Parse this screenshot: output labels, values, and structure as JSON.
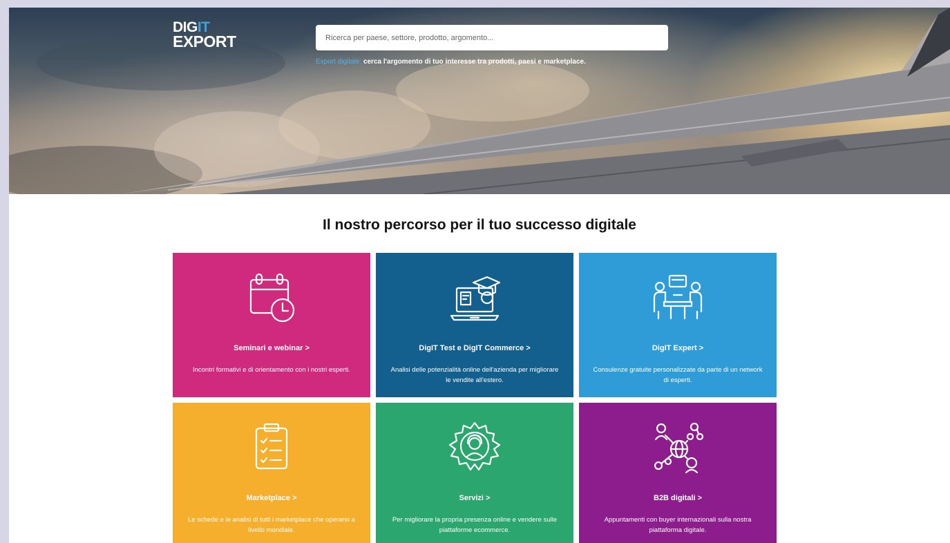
{
  "logo": {
    "line1_a": "DIG",
    "line1_b": "IT",
    "line2": "EXPORT"
  },
  "search": {
    "placeholder": "Ricerca per paese, settore, prodotto, argomento..."
  },
  "hint": {
    "lead": "Export digitale:",
    "text": " cerca l'argomento di tuo interesse tra prodotti, paesi e marketplace."
  },
  "section": {
    "title": "Il nostro percorso per il tuo successo digitale"
  },
  "cards": [
    {
      "title": "Seminari e webinar >",
      "desc": "Incontri formativi e di orientamento con i nostri esperti.",
      "icon": "calendar-clock-icon",
      "color": "#cf2a7d"
    },
    {
      "title": "DigIT Test e DigIT Commerce >",
      "desc": "Analisi delle potenzialità online dell'azienda per migliorare le vendite all'estero.",
      "icon": "laptop-graduation-icon",
      "color": "#135f8e"
    },
    {
      "title": "DigIT Expert >",
      "desc": "Consulenze gratuite personalizzate da parte di un network di esperti.",
      "icon": "meeting-table-icon",
      "color": "#2f9cd8"
    },
    {
      "title": "Marketplace >",
      "desc": "Le schede e le analisi di tutti i marketplace che operano a livello mondiale.",
      "icon": "checklist-icon",
      "color": "#f6ae2d"
    },
    {
      "title": "Servizi >",
      "desc": "Per migliorare la propria presenza online e vendere sulle piattaforme ecommerce.",
      "icon": "gear-headset-icon",
      "color": "#2ba66e"
    },
    {
      "title": "B2B digitali >",
      "desc": "Appuntamenti con buyer internazionali sulla nostra piattaforma digitale.",
      "icon": "global-network-icon",
      "color": "#8d1d8d"
    }
  ]
}
